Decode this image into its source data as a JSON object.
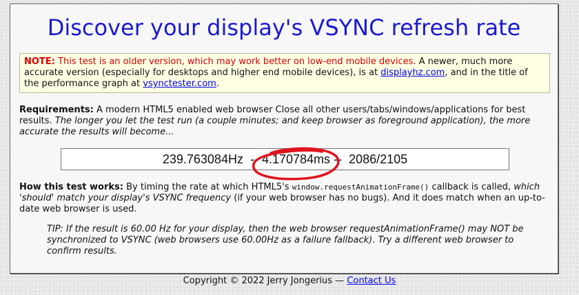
{
  "page": {
    "title": "Discover your display's VSYNC refresh rate"
  },
  "note": {
    "label": "NOTE:",
    "red_text": "This test is an older version, which may work better on low-end mobile devices.",
    "text1": "A newer, much more accurate version (especially for desktops and higher end mobile devices), is at",
    "link1": "displayhz.com",
    "text2": ", and in the title of the performance graph at",
    "link2": "vsynctester.com",
    "text3": "."
  },
  "requirements": {
    "label": "Requirements:",
    "text": "A modern HTML5 enabled web browser Close all other users/tabs/windows/applications for best results.",
    "italic": "The longer you let the test run (a couple minutes; and keep browser as foreground application), the more accurate the results will become..."
  },
  "result": {
    "hz": "239.763084Hz",
    "sep1": "  -- ",
    "ms": "4.170784ms",
    "sep2": " --  ",
    "frames": "2086/2105"
  },
  "how": {
    "label": "How this test works:",
    "text1": "By timing the rate at which HTML5's",
    "code": "window.requestAnimationFrame()",
    "text2": "callback is called,",
    "italic": "which 'should' match your display's VSYNC frequency",
    "text3": "(if your web browser has no bugs). And it does match when an up-to-date web browser is used."
  },
  "tip": {
    "text": "TIP: If the result is 60.00 Hz for your display, then the web browser requestAnimationFrame() may NOT be synchronized to VSYNC (web browsers use 60.00Hz as a failure fallback). Try a different web browser to confirm results."
  },
  "footer": {
    "copyright": "Copyright © 2022 Jerry Jongerius —",
    "contact": "Contact Us"
  },
  "colors": {
    "title": "#1a1ad0",
    "note_red": "#d40000",
    "annotation_circle": "#e0141e"
  }
}
